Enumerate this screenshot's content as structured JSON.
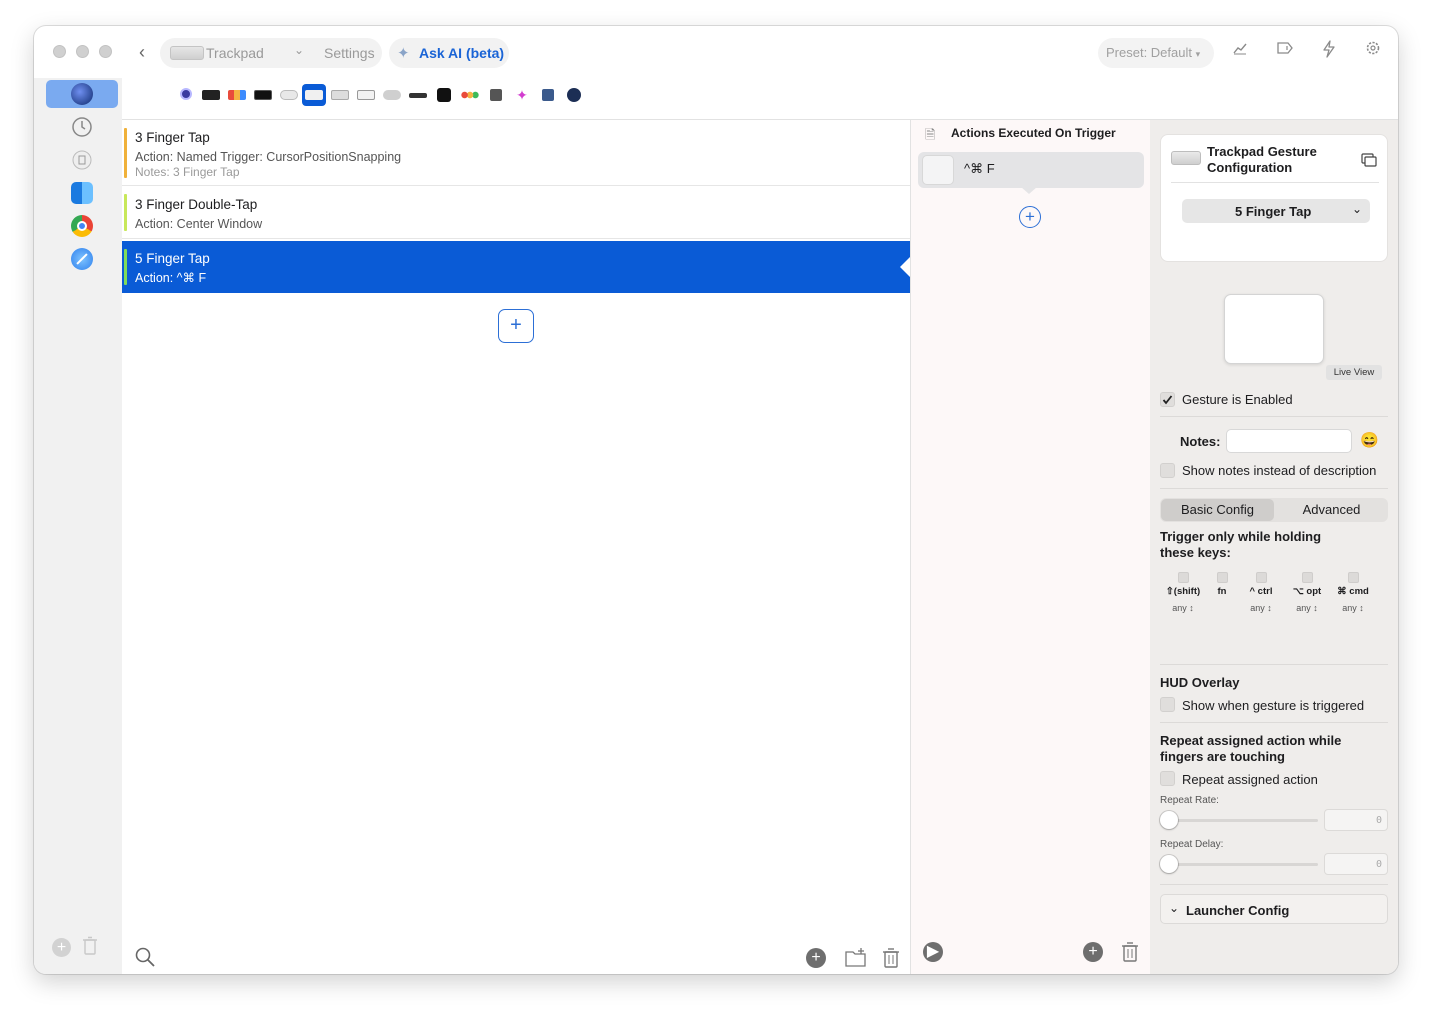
{
  "titlebar": {
    "device_label": "Trackpad",
    "settings_label": "Settings",
    "ask_ai_label": "Ask AI (beta)",
    "preset_label": "Preset: Default",
    "icons": [
      "chevron-left-icon",
      "sparkle-icon",
      "chart-icon",
      "tag-icon",
      "bolt-icon",
      "gear-icon"
    ]
  },
  "sidebar": {
    "items": [
      {
        "name": "sidebar-item-global",
        "icon": "globe-icon",
        "selected": true,
        "color": "#1d3c8f"
      },
      {
        "name": "sidebar-item-history",
        "icon": "clock-icon",
        "selected": false,
        "color": "#888888"
      },
      {
        "name": "sidebar-item-trash",
        "icon": "trash-icon",
        "selected": false,
        "color": "#aaaaaa"
      },
      {
        "name": "sidebar-item-finder",
        "icon": "finder-icon",
        "selected": false,
        "color": "#1e88e5"
      },
      {
        "name": "sidebar-item-chrome",
        "icon": "chrome-icon",
        "selected": false,
        "color": "#34a853"
      },
      {
        "name": "sidebar-item-safari",
        "icon": "safari-icon",
        "selected": false,
        "color": "#2f80ed"
      }
    ]
  },
  "device_strip": {
    "selected_index": 5,
    "items": [
      "all-devices-icon",
      "touch-bar-icon",
      "keyboard-shortcuts-icon",
      "stream-deck-icon",
      "magic-mouse-icon",
      "trackpad-icon",
      "keyboard-icon",
      "text-icon",
      "normal-mouse-icon",
      "siri-remote-icon",
      "midi-icon",
      "apple-remote-icon",
      "automations-icon",
      "floating-menu-icon",
      "drawings-icon",
      "other-icon",
      "bluetooth-icon"
    ]
  },
  "triggers": [
    {
      "title": "3 Finger Tap",
      "action": "Action: Named Trigger: CursorPositionSnapping",
      "notes": "Notes: 3 Finger Tap",
      "color": "#f0b13a"
    },
    {
      "title": "3 Finger Double-Tap",
      "action": "Action: Center Window",
      "notes": "",
      "color": "#c8e85a"
    },
    {
      "title": "5 Finger Tap",
      "action": "Action: ^⌘ F",
      "notes": "",
      "color": "#7fdc5a",
      "selected": true
    }
  ],
  "actions": {
    "header": "Actions Executed On Trigger",
    "items": [
      {
        "label": "^⌘ F"
      }
    ]
  },
  "inspector": {
    "config_title": "Trackpad Gesture Configuration",
    "gesture_select": "5 Finger Tap",
    "live_view": "Live View",
    "gesture_enabled_label": "Gesture is Enabled",
    "gesture_enabled": true,
    "notes_label": "Notes:",
    "notes_value": "",
    "emoji": "😄",
    "show_notes_label": "Show notes instead of description",
    "tabs": [
      "Basic Config",
      "Advanced"
    ],
    "active_tab": "Basic Config",
    "modifier_title": "Trigger only while holding these keys:",
    "modifiers": [
      {
        "label": "⇧(shift)",
        "mode": "any"
      },
      {
        "label": "fn",
        "mode": ""
      },
      {
        "label": "^ ctrl",
        "mode": "any"
      },
      {
        "label": "⌥ opt",
        "mode": "any"
      },
      {
        "label": "⌘ cmd",
        "mode": "any"
      }
    ],
    "hud_title": "HUD Overlay",
    "hud_label": "Show when gesture is triggered",
    "repeat_title": "Repeat assigned action while fingers are touching",
    "repeat_label": "Repeat assigned action",
    "repeat_rate_label": "Repeat Rate:",
    "repeat_rate_value": "0",
    "repeat_delay_label": "Repeat Delay:",
    "repeat_delay_value": "0",
    "launcher_label": "Launcher Config"
  }
}
